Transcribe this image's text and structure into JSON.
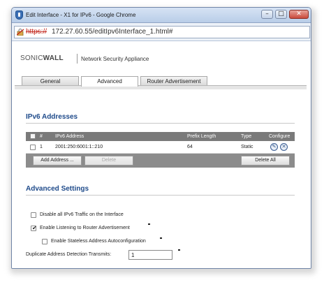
{
  "window": {
    "title": "Edit Interface - X1 for IPv6 - Google Chrome",
    "minimize_glyph": "–",
    "maximize_glyph": "□",
    "close_glyph": "✕"
  },
  "address_bar": {
    "scheme": "https://",
    "url_rest": "172.27.60.55/editIpv6Interface_1.html#"
  },
  "brand": {
    "logo_sonic": "SONIC",
    "logo_wall": "WALL",
    "product": "Network Security Appliance"
  },
  "tabs": [
    {
      "label": "General",
      "active": false
    },
    {
      "label": "Advanced",
      "active": true
    },
    {
      "label": "Router Advertisement",
      "active": false
    }
  ],
  "ipv6_addresses": {
    "title": "IPv6 Addresses",
    "columns": [
      "#",
      "IPv6 Address",
      "Prefix Length",
      "Type",
      "Configure"
    ],
    "rows": [
      {
        "num": "1",
        "address": "2001:250:6001:1::210",
        "prefix": "64",
        "type": "Static"
      }
    ],
    "buttons": {
      "add": "Add Address ...",
      "delete": "Delete",
      "delete_all": "Delete All"
    }
  },
  "advanced_settings": {
    "title": "Advanced Settings",
    "options": [
      {
        "label": "Disable all IPv6 Traffic on the Interface",
        "checked": false
      },
      {
        "label": "Enable Listening to Router Advertisement",
        "checked": true
      },
      {
        "label": "Enable Stateless Address Autoconfiguration",
        "checked": false
      }
    ],
    "dad_label": "Duplicate Address Detection Transmits:",
    "dad_value": "1"
  },
  "colors": {
    "section_title": "#1e4a8a",
    "grid_header": "#7a7a7a",
    "url_scheme_error": "#c2261c"
  }
}
